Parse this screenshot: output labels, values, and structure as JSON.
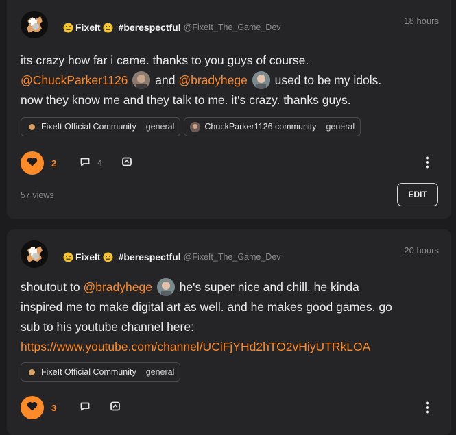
{
  "posts": [
    {
      "author_name": "FixeIt",
      "hashtag": "#berespectful",
      "handle": "@FixeIt_The_Game_Dev",
      "time": "18 hours",
      "body": {
        "l1": "its crazy how far i came. thanks to you guys of course.",
        "mention1": "@ChuckParker1126",
        "and": " and ",
        "mention2": "@bradyhege",
        "l2_tail": " used to be my idols.",
        "l3": "now they know me and they talk to me. it's crazy. thanks guys."
      },
      "chips": [
        {
          "community": "FixeIt Official Community",
          "category": "general"
        },
        {
          "community": "ChuckParker1126 community",
          "category": "general"
        }
      ],
      "likes": "2",
      "comments": "4",
      "views": "57 views",
      "edit_label": "EDIT"
    },
    {
      "author_name": "FixeIt",
      "hashtag": "#berespectful",
      "handle": "@FixeIt_The_Game_Dev",
      "time": "20 hours",
      "body": {
        "prefix": "shoutout to ",
        "mention": "@bradyhege",
        "l1_tail": " he's super nice and chill. he kinda",
        "l2": "inspired me to make digital art as well. and he makes good games. go",
        "l3": "sub to his youtube channel here:",
        "link": "https://www.youtube.com/channel/UCiFjYHd2hTO2vHiyUTRkLOA"
      },
      "chips": [
        {
          "community": "FixeIt Official Community",
          "category": "general"
        }
      ],
      "likes": "3"
    }
  ],
  "icons": {
    "like": "heart-icon",
    "comment": "comment-bubble-icon",
    "share": "share-icon",
    "more": "more-vertical-icon",
    "author_emoji": "neutral-face-emoji-icon"
  },
  "colors": {
    "accent": "#ff8a28",
    "background": "#1c1c1e",
    "card": "#252528",
    "muted": "#8a8a8a"
  }
}
